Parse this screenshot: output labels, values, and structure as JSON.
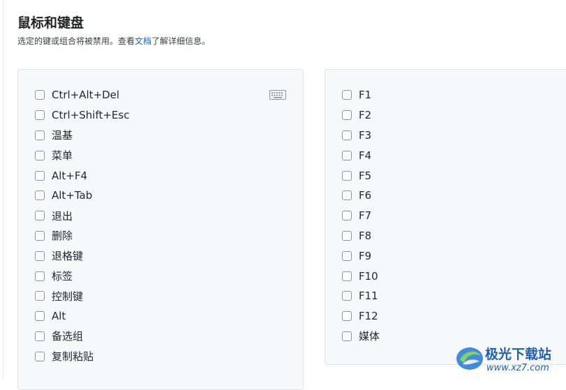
{
  "header": {
    "title": "鼠标和键盘",
    "subtitle_before": "选定的键或组合将被禁用。查看",
    "subtitle_link": "文档",
    "subtitle_after": "了解详细信息。"
  },
  "left_panel": {
    "keyboard_icon": "keyboard-icon",
    "items": [
      {
        "label": "Ctrl+Alt+Del",
        "checked": false
      },
      {
        "label": "Ctrl+Shift+Esc",
        "checked": false
      },
      {
        "label": "温基",
        "checked": false
      },
      {
        "label": "菜单",
        "checked": false
      },
      {
        "label": "Alt+F4",
        "checked": false
      },
      {
        "label": "Alt+Tab",
        "checked": false
      },
      {
        "label": "退出",
        "checked": false
      },
      {
        "label": "删除",
        "checked": false
      },
      {
        "label": "退格键",
        "checked": false
      },
      {
        "label": "标签",
        "checked": false
      },
      {
        "label": "控制键",
        "checked": false
      },
      {
        "label": "Alt",
        "checked": false
      },
      {
        "label": "备选组",
        "checked": false
      },
      {
        "label": "复制粘贴",
        "checked": false
      }
    ]
  },
  "right_panel": {
    "items": [
      {
        "label": "F1",
        "checked": false
      },
      {
        "label": "F2",
        "checked": false
      },
      {
        "label": "F3",
        "checked": false
      },
      {
        "label": "F4",
        "checked": false
      },
      {
        "label": "F5",
        "checked": false
      },
      {
        "label": "F6",
        "checked": false
      },
      {
        "label": "F7",
        "checked": false
      },
      {
        "label": "F8",
        "checked": false
      },
      {
        "label": "F9",
        "checked": false
      },
      {
        "label": "F10",
        "checked": false
      },
      {
        "label": "F11",
        "checked": false
      },
      {
        "label": "F12",
        "checked": false
      },
      {
        "label": "媒体",
        "checked": false
      }
    ]
  },
  "watermark": {
    "text": "极光下载站",
    "url": "www.xz7.com"
  },
  "colors": {
    "link": "#0969da",
    "panel_bg": "#f6f8fa",
    "panel_border": "#dfe3e8",
    "watermark": "#1c5fb5"
  }
}
